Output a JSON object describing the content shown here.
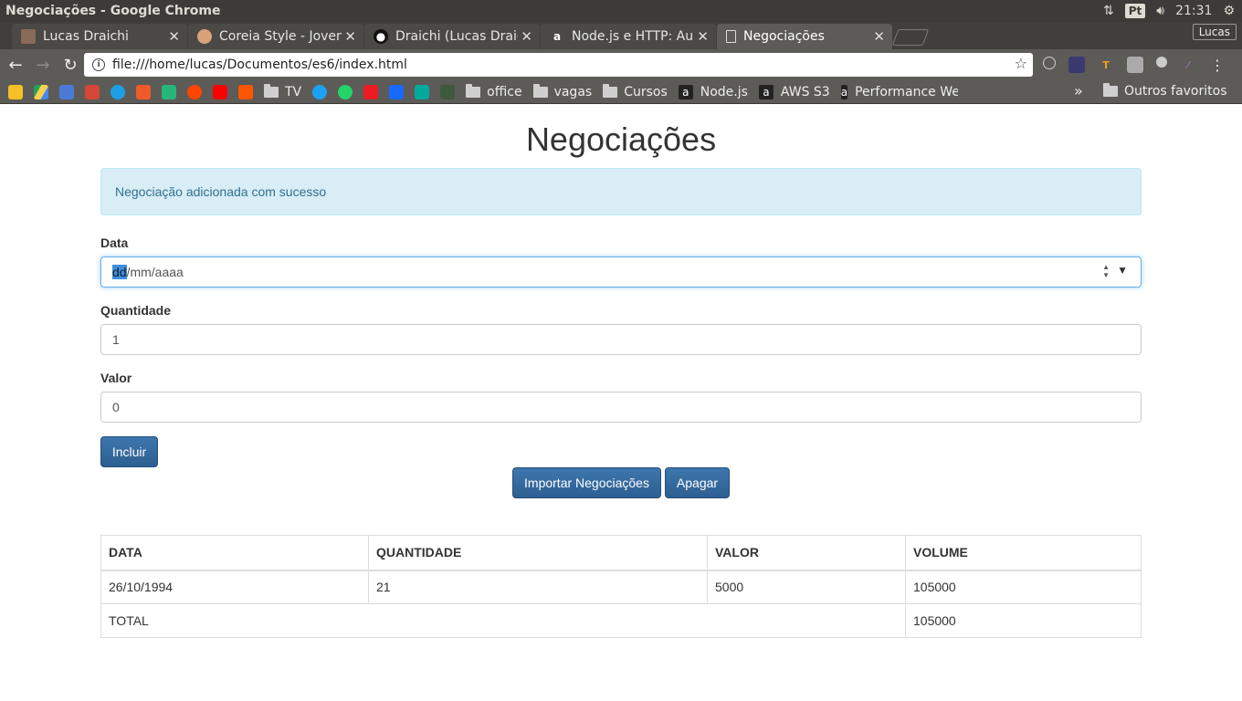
{
  "window": {
    "title": "Negociações - Google Chrome",
    "lang_badge": "Pt",
    "clock": "21:31"
  },
  "tabs": [
    {
      "label": "Lucas Draichi",
      "favicon": "user-photo-icon"
    },
    {
      "label": "Coreia Style - Jovem",
      "favicon": "avatar-icon"
    },
    {
      "label": "Draichi (Lucas Draic",
      "favicon": "github-icon"
    },
    {
      "label": "Node.js e HTTP: Aul",
      "favicon": "alura-icon"
    },
    {
      "label": "Negociações",
      "favicon": "page-icon",
      "active": true
    }
  ],
  "profile": "Lucas",
  "address_bar": {
    "url": "file:///home/lucas/Documentos/es6/index.html"
  },
  "bookmarks": {
    "folders": [
      "TV"
    ],
    "items": [
      {
        "label": "office",
        "type": "folder"
      },
      {
        "label": "vagas",
        "type": "folder"
      },
      {
        "label": "Cursos",
        "type": "folder"
      },
      {
        "label": "Node.js",
        "type": "alura"
      },
      {
        "label": "AWS S3",
        "type": "alura"
      },
      {
        "label": "Performance We",
        "type": "alura"
      }
    ],
    "more": "»",
    "others": "Outros favoritos"
  },
  "page": {
    "title": "Negociações",
    "alert": "Negociação adicionada com sucesso",
    "form": {
      "date_label": "Data",
      "date_placeholder_day": "dd",
      "date_placeholder_rest": "/mm/aaaa",
      "qty_label": "Quantidade",
      "qty_value": "1",
      "value_label": "Valor",
      "value_value": "0",
      "submit": "Incluir"
    },
    "actions": {
      "import": "Importar Negociações",
      "clear": "Apagar"
    },
    "table": {
      "headers": [
        "DATA",
        "QUANTIDADE",
        "VALOR",
        "VOLUME"
      ],
      "rows": [
        {
          "data": "26/10/1994",
          "quantidade": "21",
          "valor": "5000",
          "volume": "105000"
        }
      ],
      "footer": {
        "label": "TOTAL",
        "value": "105000"
      }
    }
  }
}
